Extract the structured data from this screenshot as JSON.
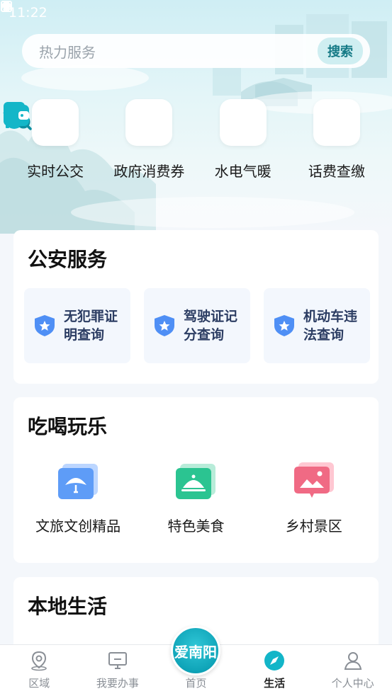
{
  "status_bar": {
    "time": "11:22"
  },
  "search": {
    "placeholder": "热力服务",
    "button_label": "搜索"
  },
  "quick_services": [
    {
      "label": "实时公交",
      "icon": "bus-search-icon"
    },
    {
      "label": "政府消费券",
      "icon": "yen-house-icon"
    },
    {
      "label": "水电气暖",
      "icon": "water-drop-search-icon"
    },
    {
      "label": "话费查缴",
      "icon": "wallet-icon"
    }
  ],
  "police": {
    "title": "公安服务",
    "items": [
      {
        "line1": "无犯罪证",
        "line2": "明查询",
        "icon": "shield-star-icon"
      },
      {
        "line1": "驾驶证记",
        "line2": "分查询",
        "icon": "shield-star-icon"
      },
      {
        "line1": "机动车违",
        "line2": "法查询",
        "icon": "shield-star-icon"
      }
    ]
  },
  "fun": {
    "title": "吃喝玩乐",
    "items": [
      {
        "label": "文旅文创精品",
        "icon": "fan-icon"
      },
      {
        "label": "特色美食",
        "icon": "dish-cover-icon"
      },
      {
        "label": "乡村景区",
        "icon": "landscape-icon"
      }
    ]
  },
  "local": {
    "title": "本地生活"
  },
  "tabbar": {
    "home_badge": "爱南阳",
    "tabs": [
      {
        "label": "区域",
        "icon": "location-pin-icon"
      },
      {
        "label": "我要办事",
        "icon": "monitor-icon"
      },
      {
        "label": "首页",
        "icon": "home-badge-icon"
      },
      {
        "label": "生活",
        "icon": "compass-icon",
        "active": true
      },
      {
        "label": "个人中心",
        "icon": "user-icon"
      }
    ]
  },
  "colors": {
    "accent": "#13b5c8",
    "tile_text": "#2c3d63",
    "shield": "#4f8ff5"
  }
}
